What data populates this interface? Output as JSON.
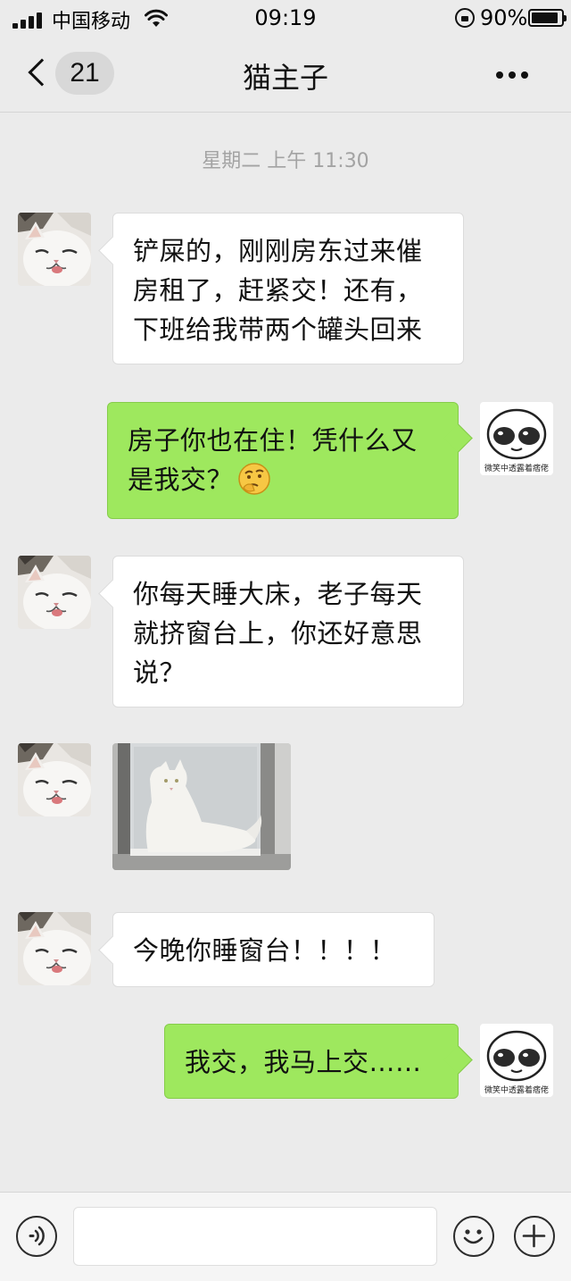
{
  "status_bar": {
    "carrier": "中国移动",
    "time": "09:19",
    "battery_percent": "90%",
    "battery_level": 0.9
  },
  "nav": {
    "unread_count": "21",
    "title": "猫主子"
  },
  "chat": {
    "timestamp": "星期二 上午 11:30",
    "messages": [
      {
        "from": "cat",
        "text": "铲屎的，刚刚房东过来催房租了，赶紧交！还有，下班给我带两个罐头回来"
      },
      {
        "from": "me",
        "text": "房子你也在住！凭什么又是我交？",
        "emoji": "thinking-face"
      },
      {
        "from": "cat",
        "text": "你每天睡大床，老子每天就挤窗台上，你还好意思说？"
      },
      {
        "from": "cat",
        "type": "image",
        "image": "white-cat-lounging-on-windowsill"
      },
      {
        "from": "cat",
        "text": "今晚你睡窗台！！！！"
      },
      {
        "from": "me",
        "text": "我交，我马上交……"
      }
    ],
    "my_avatar_caption": "微笑中透露着痞佬"
  },
  "input_bar": {
    "message_value": ""
  },
  "colors": {
    "background": "#ebebeb",
    "my_bubble": "#9ee85e",
    "their_bubble": "#ffffff",
    "timestamp": "#a3a3a3"
  }
}
